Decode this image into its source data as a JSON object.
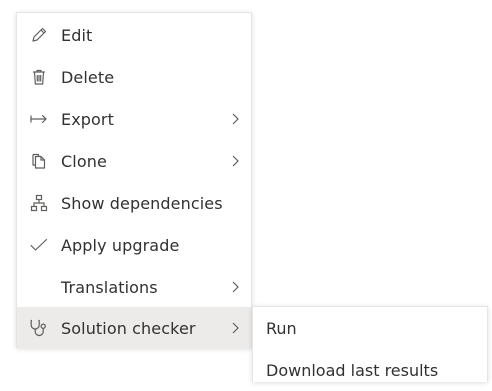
{
  "menu": {
    "items": [
      {
        "label": "Edit",
        "icon": "pencil-icon"
      },
      {
        "label": "Delete",
        "icon": "trash-icon"
      },
      {
        "label": "Export",
        "icon": "export-arrow-icon",
        "submenu": true
      },
      {
        "label": "Clone",
        "icon": "clone-icon",
        "submenu": true
      },
      {
        "label": "Show dependencies",
        "icon": "hierarchy-icon"
      },
      {
        "label": "Apply upgrade",
        "icon": "checkmark-icon"
      },
      {
        "label": "Translations",
        "icon": "",
        "submenu": true
      },
      {
        "label": "Solution checker",
        "icon": "stethoscope-icon",
        "submenu": true,
        "active": true
      }
    ]
  },
  "submenu": {
    "items": [
      {
        "label": "Run"
      },
      {
        "label": "Download last results"
      }
    ]
  },
  "colors": {
    "icon": "#605e5c",
    "text": "#323130",
    "active_bg": "#edebe9",
    "border": "#e5e5e5"
  }
}
